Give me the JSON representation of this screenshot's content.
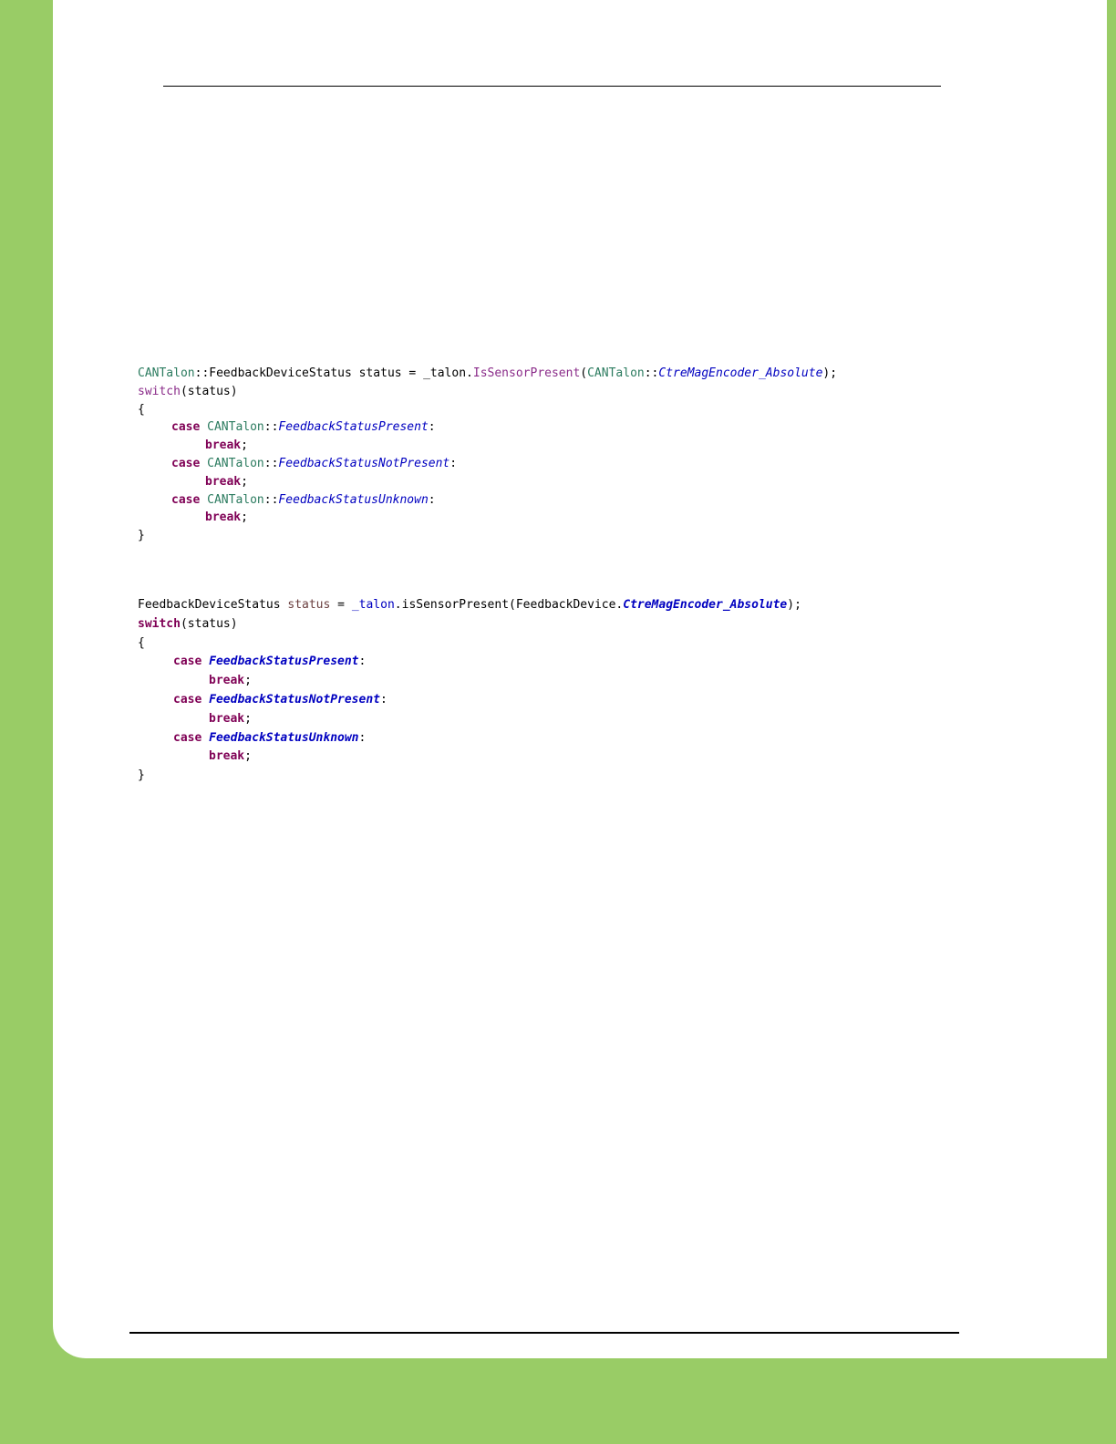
{
  "colors": {
    "border_green": "#99cc66",
    "page_white": "#ffffff",
    "keyword": "#7f0055",
    "type_name": "#2b7b5f",
    "method": "#8a2b89",
    "enum_constant": "#0000c0",
    "local_variable": "#6a3e3e"
  },
  "cpp_snippet": {
    "line1": {
      "cls1": "CANTalon",
      "p1": "::FeedbackDeviceStatus status = _talon.",
      "method": "IsSensorPresent",
      "p2": "(",
      "cls2": "CANTalon",
      "p3": "::",
      "enum": "CtreMagEncoder_Absolute",
      "p4": ");"
    },
    "line2": {
      "kw": "switch",
      "rest": "(status)"
    },
    "line3": "{",
    "cases": [
      {
        "kw": "case",
        "cls": "CANTalon",
        "sep": "::",
        "enum": "FeedbackStatusPresent",
        "colon": ":",
        "brk": "break",
        "semi": ";"
      },
      {
        "kw": "case",
        "cls": "CANTalon",
        "sep": "::",
        "enum": "FeedbackStatusNotPresent",
        "colon": ":",
        "brk": "break",
        "semi": ";"
      },
      {
        "kw": "case",
        "cls": "CANTalon",
        "sep": "::",
        "enum": "FeedbackStatusUnknown",
        "colon": ":",
        "brk": "break",
        "semi": ";"
      }
    ],
    "close": "}"
  },
  "java_snippet": {
    "line1": {
      "type": "FeedbackDeviceStatus ",
      "local": "status",
      "p1": " = ",
      "field": "_talon",
      "p2": ".isSensorPresent(FeedbackDevice.",
      "enum": "CtreMagEncoder_Absolute",
      "p3": ");"
    },
    "line2": {
      "kw": "switch",
      "rest": "(status)"
    },
    "line3": "{",
    "cases": [
      {
        "kw": "case",
        "enum": "FeedbackStatusPresent",
        "colon": ":",
        "brk": "break",
        "semi": ";"
      },
      {
        "kw": "case",
        "enum": "FeedbackStatusNotPresent",
        "colon": ":",
        "brk": "break",
        "semi": ";"
      },
      {
        "kw": "case",
        "enum": "FeedbackStatusUnknown",
        "colon": ":",
        "brk": "break",
        "semi": ";"
      }
    ],
    "close": "}"
  }
}
